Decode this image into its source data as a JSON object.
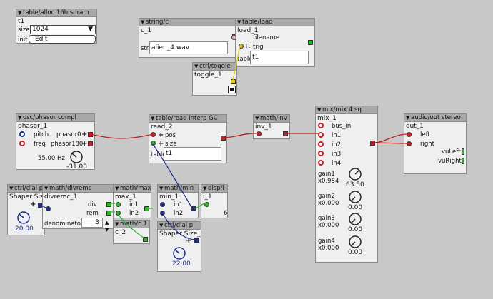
{
  "colors": {
    "background": "#c8c8c8",
    "header": "#a8a8a8",
    "audio_wire": "#c02020",
    "control_wire": "#1c2a90",
    "bool_wire": "#2ab52a",
    "trigger_wire": "#e0c820"
  },
  "alloc": {
    "title": "table/alloc 16b sdram",
    "instance": "t1",
    "size_label": "size",
    "size_value": "1024",
    "init_label": "init",
    "edit_label": "Edit"
  },
  "stringc": {
    "title": "string/c",
    "instance": "c_1",
    "str_label": "str",
    "str_value": "alien_4.wav"
  },
  "tload": {
    "title": "table/load",
    "instance": "load_1",
    "filename_label": "filename",
    "trig_label": "trig",
    "table_label": "table",
    "table_value": "t1"
  },
  "toggle": {
    "title": "ctrl/toggle",
    "instance": "toggle_1"
  },
  "phasor": {
    "title": "osc/phasor compl",
    "instance": "phasor_1",
    "pitch_label": "pitch",
    "freq_label": "freq",
    "out0_label": "phasor0",
    "out180_label": "phasor180",
    "hz_value": "55.00 Hz",
    "dial_value": "-31.00"
  },
  "tread": {
    "title": "table/read interp GC",
    "instance": "read_2",
    "pos_label": "pos",
    "size_label": "size",
    "table_label": "table",
    "table_value": "t1"
  },
  "inv": {
    "title": "math/inv",
    "instance": "inv_1"
  },
  "mix": {
    "title": "mix/mix 4 sq",
    "instance": "mix_1",
    "inputs": [
      "bus_in",
      "in1",
      "in2",
      "in3",
      "in4"
    ],
    "gains": [
      {
        "label": "gain1",
        "value": "x0.984",
        "dial": "63.50"
      },
      {
        "label": "gain2",
        "value": "x0.000",
        "dial": "0.00"
      },
      {
        "label": "gain3",
        "value": "x0.000",
        "dial": "0.00"
      },
      {
        "label": "gain4",
        "value": "x0.000",
        "dial": "0.00"
      }
    ]
  },
  "audioout": {
    "title": "audio/out stereo",
    "instance": "out_1",
    "left_label": "left",
    "right_label": "right",
    "vuleft_label": "vuLeft",
    "vuright_label": "vuRight"
  },
  "dial1": {
    "title": "ctrl/dial p",
    "instance": "Shaper Size",
    "value": "20.00"
  },
  "divremc": {
    "title": "math/divremc",
    "instance": "divremc_1",
    "div_label": "div",
    "rem_label": "rem",
    "denominator_label": "denominator",
    "denominator_value": "3"
  },
  "max": {
    "title": "math/max",
    "instance": "max_1",
    "in1_label": "in1",
    "in2_label": "in2"
  },
  "min": {
    "title": "math/min",
    "instance": "min_1",
    "in1_label": "in1",
    "in2_label": "in2"
  },
  "disp": {
    "title": "disp/i",
    "instance": "i_1",
    "value": "6"
  },
  "mathc": {
    "title": "math/c 1",
    "instance": "c_2"
  },
  "dial2": {
    "title": "ctrl/dial p",
    "instance": "Shaper Size_",
    "value": "22.00"
  }
}
